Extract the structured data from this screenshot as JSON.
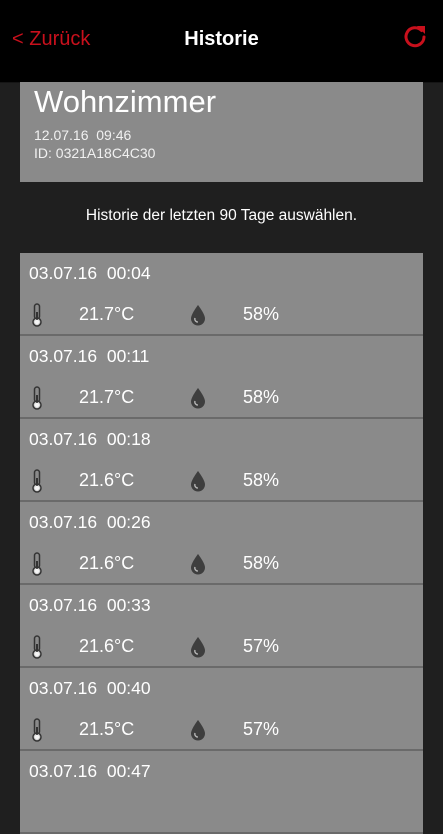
{
  "nav": {
    "back_label": "< Zurück",
    "title": "Historie",
    "accent": "#c8101c"
  },
  "device": {
    "name": "Wohnzimmer",
    "date": "12.07.16  09:46",
    "id": "ID: 0321A18C4C30"
  },
  "hint": "Historie der letzten 90 Tage auswählen.",
  "history": [
    {
      "datetime": "03.07.16  00:04",
      "temperature": "21.7°C",
      "humidity": "58%"
    },
    {
      "datetime": "03.07.16  00:11",
      "temperature": "21.7°C",
      "humidity": "58%"
    },
    {
      "datetime": "03.07.16  00:18",
      "temperature": "21.6°C",
      "humidity": "58%"
    },
    {
      "datetime": "03.07.16  00:26",
      "temperature": "21.6°C",
      "humidity": "58%"
    },
    {
      "datetime": "03.07.16  00:33",
      "temperature": "21.6°C",
      "humidity": "57%"
    },
    {
      "datetime": "03.07.16  00:40",
      "temperature": "21.5°C",
      "humidity": "57%"
    },
    {
      "datetime": "03.07.16  00:47"
    }
  ],
  "icons": {
    "temperature": "thermometer-icon",
    "humidity": "water-drop-icon",
    "refresh": "refresh-icon"
  }
}
